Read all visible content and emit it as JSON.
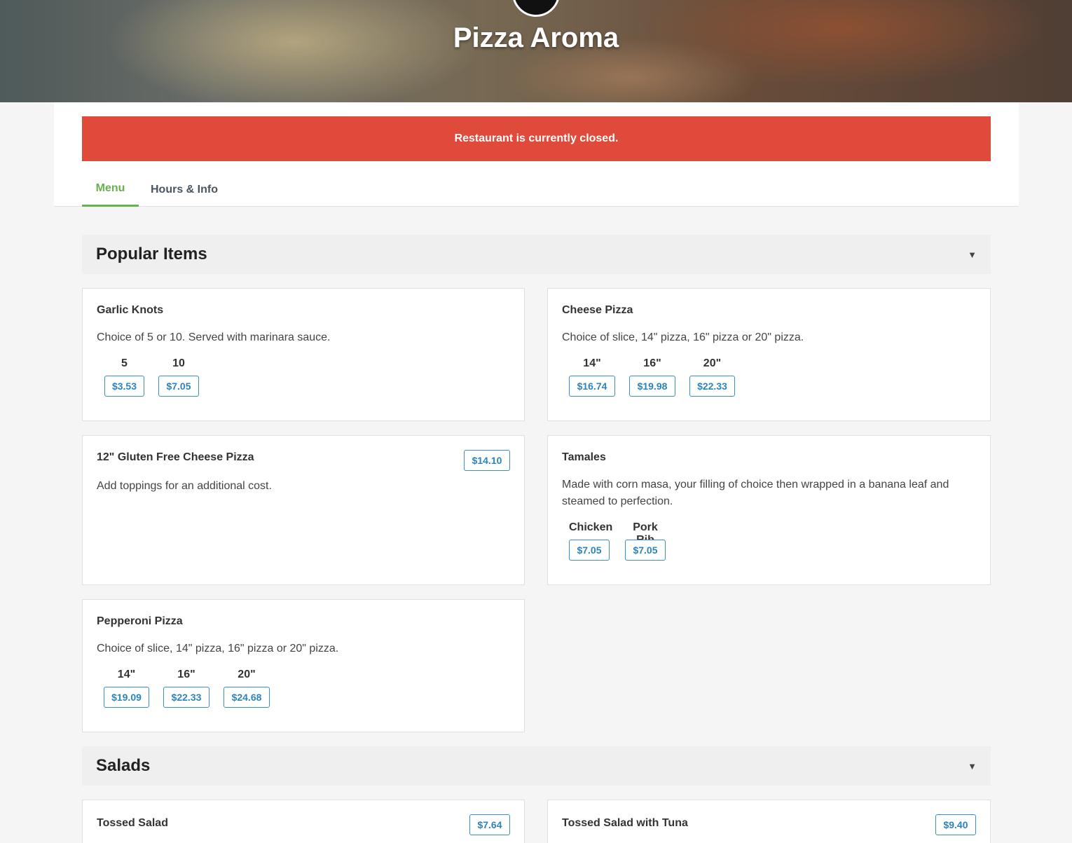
{
  "restaurant": {
    "name": "Pizza Aroma",
    "status_message": "Restaurant is currently closed."
  },
  "tabs": [
    {
      "label": "Menu",
      "active": true
    },
    {
      "label": "Hours & Info",
      "active": false
    }
  ],
  "sections": [
    {
      "title": "Popular Items",
      "caret": "▼",
      "items": [
        {
          "name": "Garlic Knots",
          "description": "Choice of 5 or 10. Served with marinara sauce.",
          "options": [
            {
              "label": "5",
              "price": "$3.53"
            },
            {
              "label": "10",
              "price": "$7.05"
            }
          ]
        },
        {
          "name": "Cheese Pizza",
          "description": "Choice of slice, 14\" pizza, 16\" pizza or 20\" pizza.",
          "options": [
            {
              "label": "14\"",
              "price": "$16.74"
            },
            {
              "label": "16\"",
              "price": "$19.98"
            },
            {
              "label": "20\"",
              "price": "$22.33"
            }
          ]
        },
        {
          "name": "12\" Gluten Free Cheese Pizza",
          "description": "Add toppings for an additional cost.",
          "price": "$14.10"
        },
        {
          "name": "Tamales",
          "description_line1": "Made with corn masa, your filling of choice then wrapped in a banana leaf and",
          "description_line2": "steamed to perfection.",
          "options": [
            {
              "label": "Chicken",
              "price": "$7.05"
            },
            {
              "label": "Pork Rib",
              "price": "$7.05"
            }
          ]
        },
        {
          "name": "Pepperoni Pizza",
          "description": "Choice of slice, 14\" pizza, 16\" pizza or 20\" pizza.",
          "options": [
            {
              "label": "14\"",
              "price": "$19.09"
            },
            {
              "label": "16\"",
              "price": "$22.33"
            },
            {
              "label": "20\"",
              "price": "$24.68"
            }
          ]
        }
      ]
    },
    {
      "title": "Salads",
      "caret": "▼",
      "items": [
        {
          "name": "Tossed Salad",
          "price": "$7.64"
        },
        {
          "name": "Tossed Salad with Tuna",
          "price": "$9.40"
        }
      ]
    }
  ],
  "colors": {
    "alert": "#e04a3a",
    "active_tab": "#6ab04c",
    "price_accent": "#2c83bd"
  }
}
